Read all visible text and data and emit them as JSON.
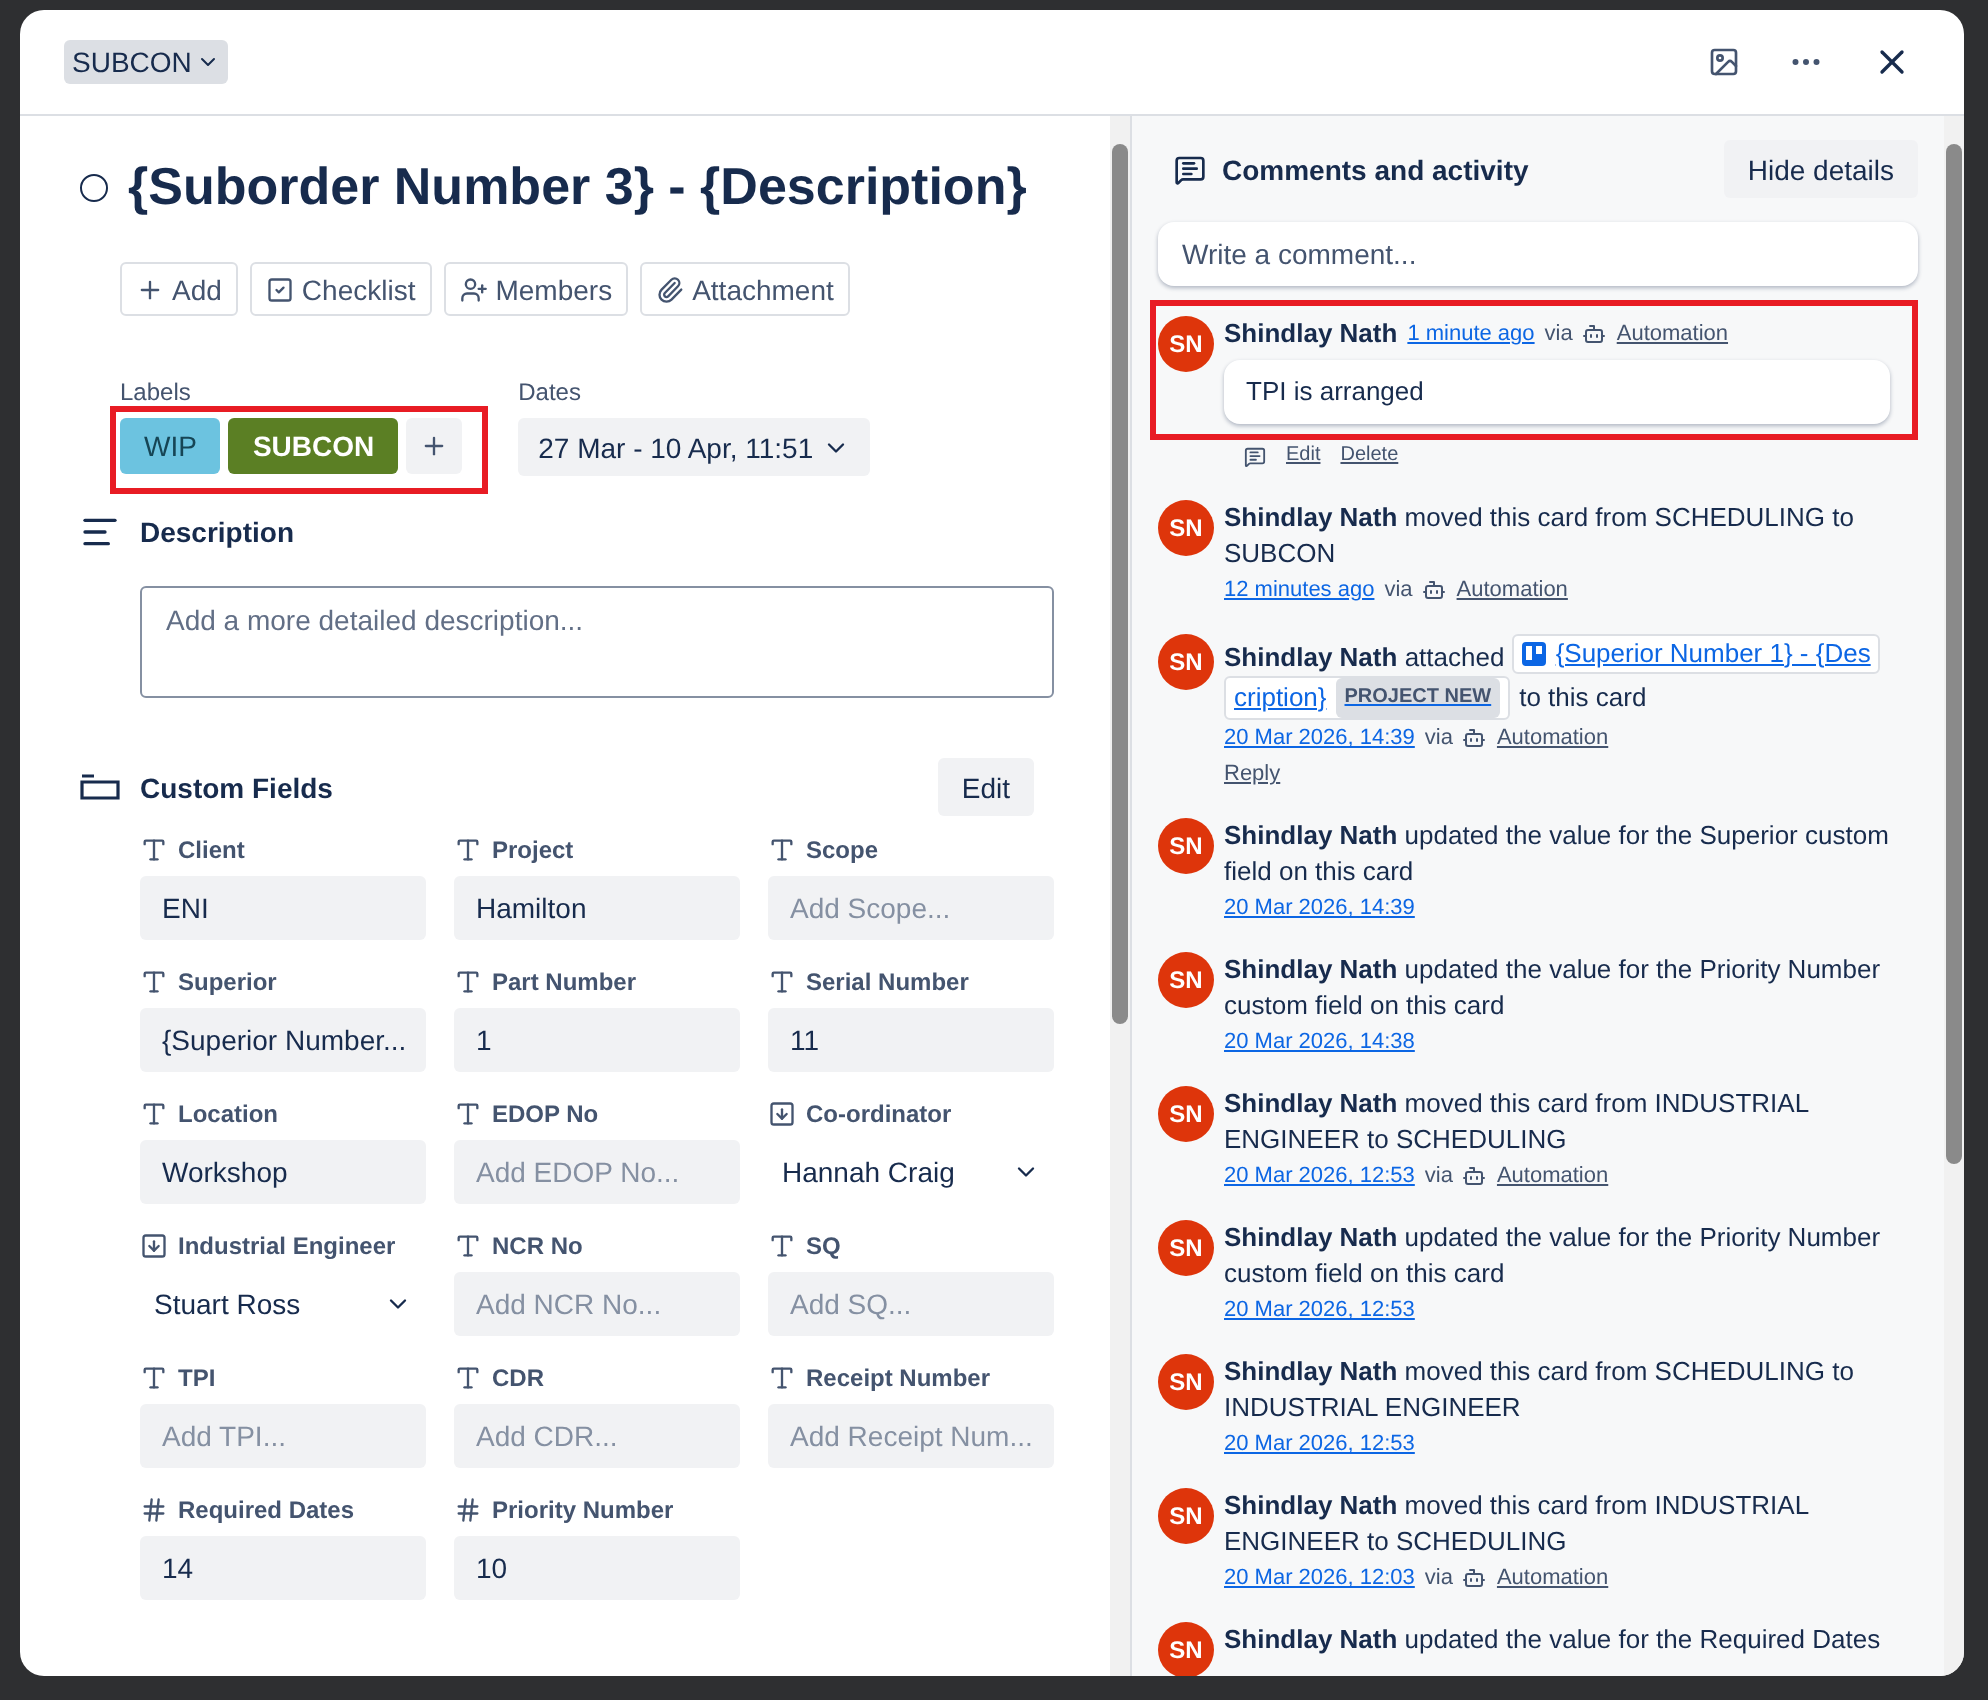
{
  "header": {
    "list_name": "SUBCON"
  },
  "card": {
    "title": "{Suborder Number 3} - {Description}",
    "completed": false
  },
  "actions": [
    {
      "kind": "add",
      "label": "Add"
    },
    {
      "kind": "checklist",
      "label": "Checklist"
    },
    {
      "kind": "members",
      "label": "Members"
    },
    {
      "kind": "attachment",
      "label": "Attachment"
    }
  ],
  "labels": {
    "heading": "Labels",
    "highlighted": true,
    "items": [
      {
        "text": "WIP",
        "color": "#6cc3e0"
      },
      {
        "text": "SUBCON",
        "color": "#5b7f24"
      }
    ]
  },
  "dates": {
    "heading": "Dates",
    "value": "27 Mar - 10 Apr, 11:51"
  },
  "description": {
    "heading": "Description",
    "placeholder": "Add a more detailed description..."
  },
  "custom_fields": {
    "heading": "Custom Fields",
    "edit_label": "Edit",
    "fields": [
      {
        "kind": "text",
        "label": "Client",
        "value": "ENI"
      },
      {
        "kind": "text",
        "label": "Project",
        "value": "Hamilton"
      },
      {
        "kind": "text",
        "label": "Scope",
        "placeholder": "Add Scope..."
      },
      {
        "kind": "text",
        "label": "Superior",
        "value": "{Superior Number..."
      },
      {
        "kind": "text",
        "label": "Part Number",
        "value": "1"
      },
      {
        "kind": "text",
        "label": "Serial Number",
        "value": "11"
      },
      {
        "kind": "text",
        "label": "Location",
        "value": "Workshop"
      },
      {
        "kind": "text",
        "label": "EDOP No",
        "placeholder": "Add EDOP No..."
      },
      {
        "kind": "select",
        "label": "Co-ordinator",
        "value": "Hannah Craig"
      },
      {
        "kind": "select",
        "label": "Industrial Engineer",
        "value": "Stuart Ross"
      },
      {
        "kind": "text",
        "label": "NCR No",
        "placeholder": "Add NCR No..."
      },
      {
        "kind": "text",
        "label": "SQ",
        "placeholder": "Add SQ..."
      },
      {
        "kind": "text",
        "label": "TPI",
        "placeholder": "Add TPI..."
      },
      {
        "kind": "text",
        "label": "CDR",
        "placeholder": "Add CDR..."
      },
      {
        "kind": "text",
        "label": "Receipt Number",
        "placeholder": "Add Receipt Num..."
      },
      {
        "kind": "number",
        "label": "Required Dates",
        "value": "14"
      },
      {
        "kind": "number",
        "label": "Priority Number",
        "value": "10"
      }
    ]
  },
  "activity": {
    "heading": "Comments and activity",
    "hide_button": "Hide details",
    "comment_placeholder": "Write a comment...",
    "items": [
      {
        "kind": "comment",
        "initials": "SN",
        "author": "Shindlay Nath",
        "time": "1 minute ago",
        "via": "via",
        "source": "Automation",
        "comment": "TPI is arranged",
        "links": [
          "Edit",
          "Delete"
        ],
        "highlighted": true
      },
      {
        "kind": "action",
        "initials": "SN",
        "text": "**Shindlay Nath** moved this card from SCHEDULING to SUBCON",
        "time": "12 minutes ago",
        "via": "via",
        "source": "Automation"
      },
      {
        "kind": "attachment",
        "initials": "SN",
        "author": "Shindlay Nath",
        "verb": "attached",
        "attachment": "{Superior Number 1} - {Des",
        "attachment_rest": "cription}",
        "attachment_list": "PROJECT NEW",
        "after": "to this card",
        "time": "20 Mar 2026, 14:39",
        "via": "via",
        "source": "Automation",
        "reply": "Reply"
      },
      {
        "kind": "action",
        "initials": "SN",
        "text": "**Shindlay Nath** updated the value for the Superior custom field on this card",
        "time": "20 Mar 2026, 14:39"
      },
      {
        "kind": "action",
        "initials": "SN",
        "text": "**Shindlay Nath** updated the value for the Priority Number custom field on this card",
        "time": "20 Mar 2026, 14:38"
      },
      {
        "kind": "action",
        "initials": "SN",
        "text": "**Shindlay Nath** moved this card from INDUSTRIAL ENGINEER to SCHEDULING",
        "time": "20 Mar 2026, 12:53",
        "via": "via",
        "source": "Automation"
      },
      {
        "kind": "action",
        "initials": "SN",
        "text": "**Shindlay Nath** updated the value for the Priority Number custom field on this card",
        "time": "20 Mar 2026, 12:53"
      },
      {
        "kind": "action",
        "initials": "SN",
        "text": "**Shindlay Nath** moved this card from SCHEDULING to INDUSTRIAL ENGINEER",
        "time": "20 Mar 2026, 12:53"
      },
      {
        "kind": "action",
        "initials": "SN",
        "text": "**Shindlay Nath** moved this card from INDUSTRIAL ENGINEER to SCHEDULING",
        "time": "20 Mar 2026, 12:03",
        "via": "via",
        "source": "Automation"
      },
      {
        "kind": "action",
        "initials": "SN",
        "text": "**Shindlay Nath** updated the value for the Required Dates"
      }
    ]
  }
}
